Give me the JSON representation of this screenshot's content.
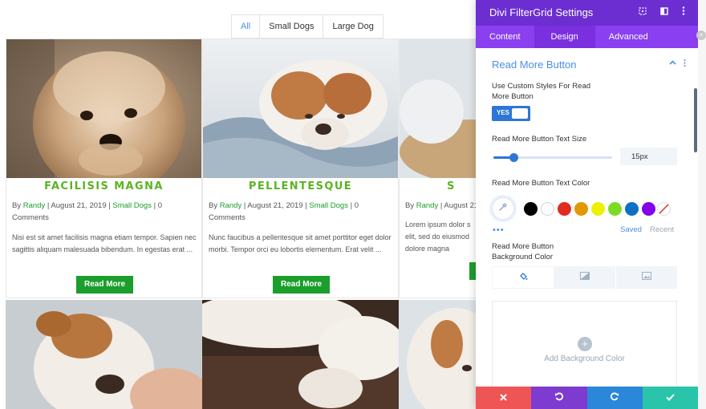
{
  "filter_tabs": [
    {
      "label": "All",
      "active": true
    },
    {
      "label": "Small Dogs",
      "active": false
    },
    {
      "label": "Large Dog",
      "active": false
    }
  ],
  "cards": [
    {
      "title": "FACILISIS MAGNA",
      "meta_by": "By ",
      "author": "Randy",
      "meta_date": " | August 21, 2019 | ",
      "category": "Small Dogs",
      "meta_tail": " | 0 Comments",
      "excerpt": "Nisi est sit amet facilisis magna etiam tempor. Sapien nec sagittis aliquam malesuada bibendum. In egestas erat ...",
      "button": "Read More"
    },
    {
      "title": "PELLENTESQUE",
      "meta_by": "By ",
      "author": "Randy",
      "meta_date": " | August 21, 2019 | ",
      "category": "Small Dogs",
      "meta_tail": " | 0 Comments",
      "excerpt": "Nunc faucibus a pellentesque sit amet porttitor eget dolor morbi. Tempor orci eu lobortis elementum. Erat velit ...",
      "button": "Read More"
    },
    {
      "title": "S",
      "meta_by": "By ",
      "author": "Randy",
      "meta_date": " | August 21",
      "category": "",
      "meta_tail": "",
      "excerpt": "Lorem ipsum dolor s elit, sed do eiusmod dolore magna",
      "button": ""
    }
  ],
  "panel": {
    "title": "Divi FilterGrid Settings",
    "header_icons": [
      "focus-icon",
      "sidebar-toggle-icon",
      "more-vertical-icon"
    ],
    "tabs": [
      {
        "label": "Content",
        "active": false
      },
      {
        "label": "Design",
        "active": true
      },
      {
        "label": "Advanced",
        "active": false
      }
    ],
    "section_title": "Read More Button",
    "custom_styles_label": "Use Custom Styles For Read More Button",
    "toggle_label": "YES",
    "toggle_on": true,
    "text_size_label": "Read More Button Text Size",
    "text_size_value": "15px",
    "text_size_slider_fraction": 0.17,
    "text_color_label": "Read More Button Text Color",
    "swatches": [
      "#000000",
      "#ffffff",
      "#e02b20",
      "#e09900",
      "#edf000",
      "#7cda24",
      "#0c71c3",
      "#8300e9"
    ],
    "saved_label": "Saved",
    "recent_label": "Recent",
    "bg_color_label": "Read More Button Background Color",
    "bg_tabs": [
      "paint-bucket-icon",
      "gradient-icon",
      "image-icon"
    ],
    "add_bg_label": "Add Background Color",
    "footer_colors": [
      "#ef5555",
      "#7e3bd0",
      "#2b87da",
      "#29c4a9"
    ]
  }
}
